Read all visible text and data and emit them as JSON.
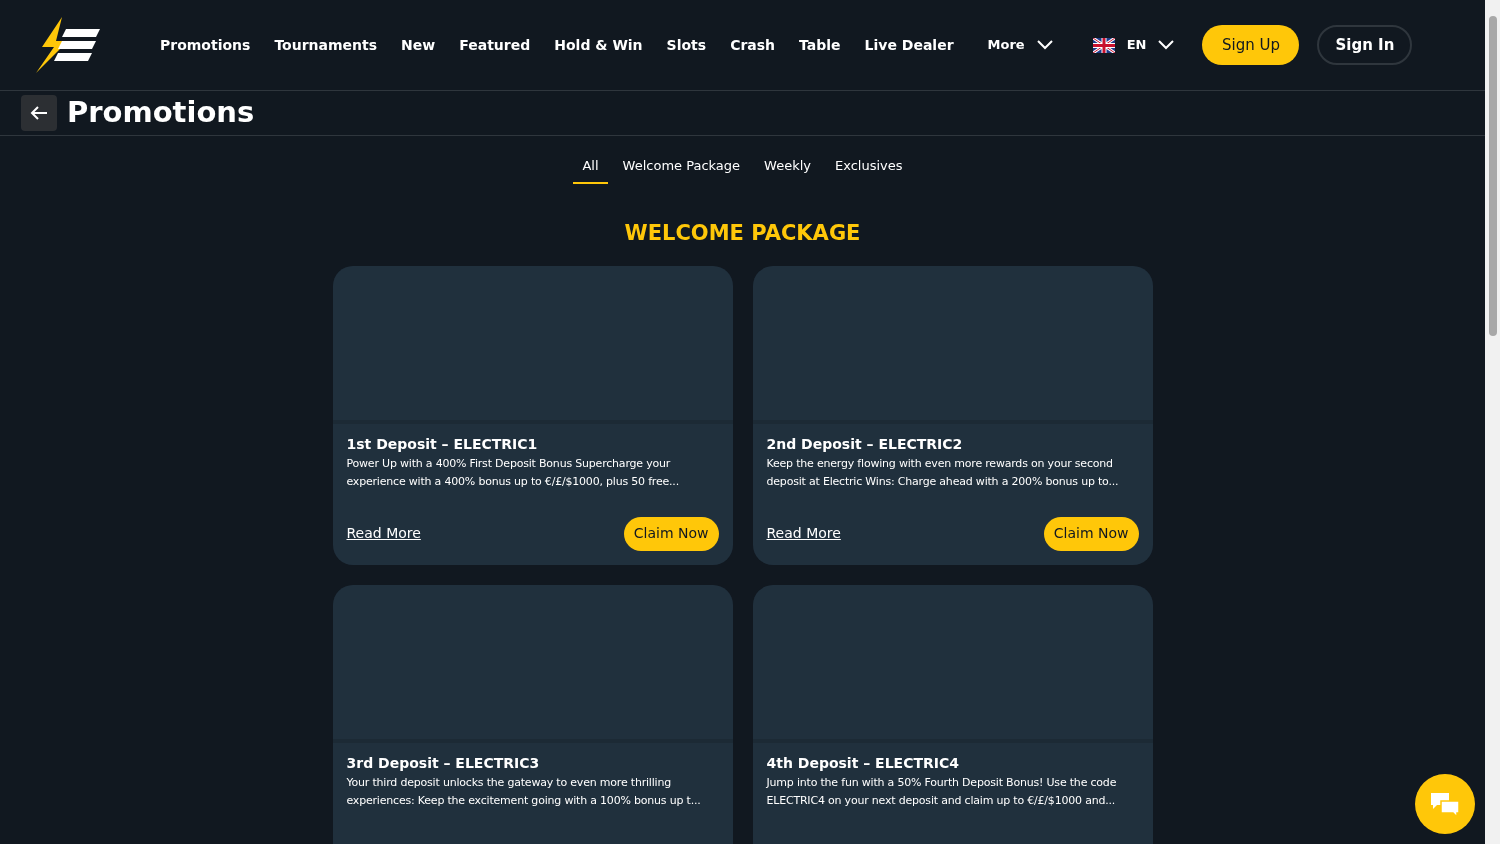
{
  "nav": {
    "items": [
      "Promotions",
      "Tournaments",
      "New",
      "Featured",
      "Hold & Win",
      "Slots",
      "Crash",
      "Table",
      "Live Dealer"
    ],
    "more": "More",
    "language": "EN",
    "sign_up": "Sign Up",
    "sign_in": "Sign In"
  },
  "page": {
    "title": "Promotions"
  },
  "tabs": [
    {
      "label": "All",
      "selected": true
    },
    {
      "label": "Welcome Package",
      "selected": false
    },
    {
      "label": "Weekly",
      "selected": false
    },
    {
      "label": "Exclusives",
      "selected": false
    }
  ],
  "section": {
    "heading": "WELCOME PACKAGE"
  },
  "cards": [
    {
      "title": "1st Deposit – ELECTRIC1",
      "description": "Power Up with a 400% First Deposit Bonus Supercharge your experience with a 400% bonus up to €/£/$1000, plus 50 free...",
      "read_more": "Read More",
      "claim": "Claim Now"
    },
    {
      "title": "2nd Deposit – ELECTRIC2",
      "description": "Keep the energy flowing with even more rewards on your second deposit at Electric Wins: Charge ahead with a 200% bonus up to...",
      "read_more": "Read More",
      "claim": "Claim Now"
    },
    {
      "title": "3rd Deposit – ELECTRIC3",
      "description": "Your third deposit unlocks the gateway to even more thrilling experiences: Keep the excitement going with a 100% bonus up t..."
    },
    {
      "title": "4th Deposit – ELECTRIC4",
      "description": "Jump into the fun with a 50% Fourth Deposit Bonus! Use the code ELECTRIC4 on your next deposit and claim up to €/£/$1000 and..."
    }
  ]
}
